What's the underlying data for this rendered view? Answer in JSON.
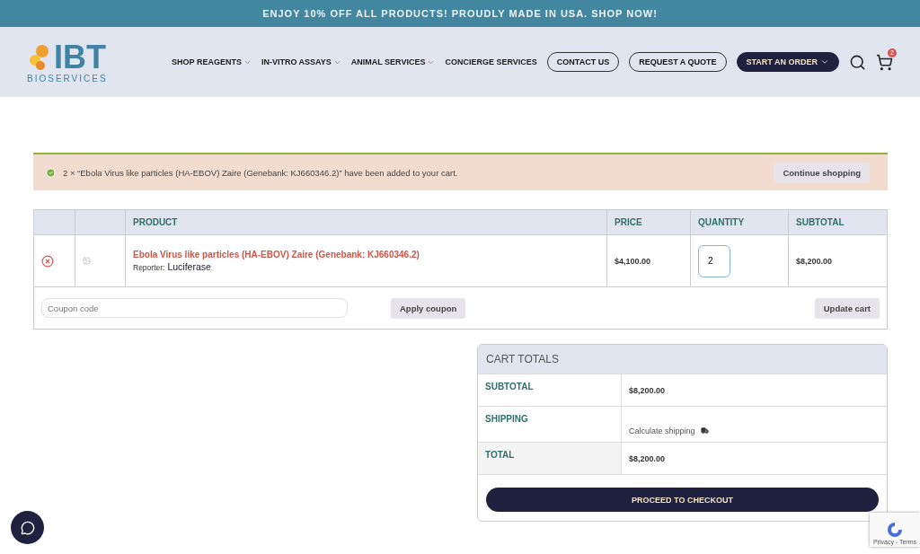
{
  "banner": {
    "text": "ENJOY 10% OFF ALL PRODUCTS! PROUDLY MADE IN USA. SHOP NOW!"
  },
  "header": {
    "logo": {
      "mark": "IBT",
      "subtitle": "BIOSERVICES"
    },
    "nav": [
      {
        "label": "SHOP REAGENTS",
        "has_dropdown": true
      },
      {
        "label": "IN-VITRO ASSAYS",
        "has_dropdown": true
      },
      {
        "label": "ANIMAL SERVICES",
        "has_dropdown": true
      },
      {
        "label": "CONCIERGE SERVICES",
        "has_dropdown": false
      }
    ],
    "buttons": [
      {
        "label": "CONTACT US",
        "kind": "outline",
        "has_dropdown": false
      },
      {
        "label": "REQUEST A QUOTE",
        "kind": "outline",
        "has_dropdown": false
      },
      {
        "label": "START AN ORDER",
        "kind": "filled",
        "has_dropdown": true
      }
    ],
    "cart_count": "2"
  },
  "notice": {
    "message": "2 × “Ebola Virus like particles (HA-EBOV) Zaire (Genebank: KJ660346.2)” have been added to your cart.",
    "button": "Continue shopping"
  },
  "cart_table": {
    "columns": [
      "PRODUCT",
      "PRICE",
      "QUANTITY",
      "SUBTOTAL"
    ],
    "rows": [
      {
        "product": "Ebola Virus like particles (HA-EBOV) Zaire (Genebank: KJ660346.2)",
        "meta_label": "Reporter:",
        "meta_value": "Luciferase",
        "price": "$4,100.00",
        "quantity": "2",
        "subtotal": "$8,200.00"
      }
    ],
    "coupon": {
      "placeholder": "Coupon code",
      "button": "Apply coupon"
    },
    "update_button": "Update cart"
  },
  "cart_totals": {
    "title": "CART TOTALS",
    "rows": [
      {
        "label": "SUBTOTAL",
        "value": "$8,200.00",
        "kind": "amount"
      },
      {
        "label": "SHIPPING",
        "value": "Calculate shipping",
        "kind": "shipping"
      },
      {
        "label": "TOTAL",
        "value": "$8,200.00",
        "kind": "amount"
      }
    ],
    "checkout_button": "PROCEED TO CHECKOUT"
  },
  "recaptcha": {
    "text": "Privacy - Terms"
  }
}
